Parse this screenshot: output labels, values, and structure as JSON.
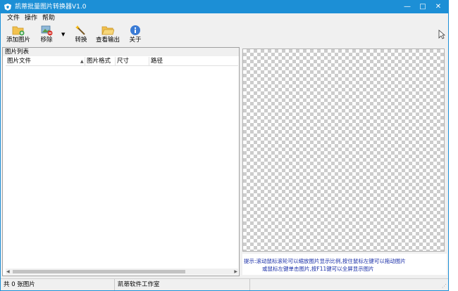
{
  "window": {
    "title": "凯蒂批量图片转换器V1.0",
    "accent": "#1c8fd6",
    "controls": {
      "minimize": "—",
      "maximize": "□",
      "close": "✕"
    }
  },
  "menu": {
    "items": [
      "文件",
      "操作",
      "帮助"
    ]
  },
  "toolbar": {
    "items": [
      {
        "label": "添加图片",
        "icon": "add-folder-icon"
      },
      {
        "label": "移除",
        "icon": "remove-image-icon"
      },
      {
        "label": "转换",
        "icon": "magic-wand-icon"
      },
      {
        "label": "查看输出",
        "icon": "open-folder-icon"
      },
      {
        "label": "关于",
        "icon": "info-icon"
      }
    ],
    "dropdown_arrow": "▼"
  },
  "image_list": {
    "title": "图片列表",
    "columns": [
      "图片文件",
      "图片格式",
      "尺寸",
      "路径"
    ],
    "sort_indicator": "▲",
    "rows": []
  },
  "preview": {
    "hint_line1": "提示:滚动鼠标滚轮可以缩放图片显示比例,按住鼠标左键可以拖动图片",
    "hint_line2": "或鼠标左键单击图片,按F11键可以全屏显示图片"
  },
  "status": {
    "count": "共 0 张图片",
    "studio": "凯蒂软件工作室",
    "extra": ""
  }
}
